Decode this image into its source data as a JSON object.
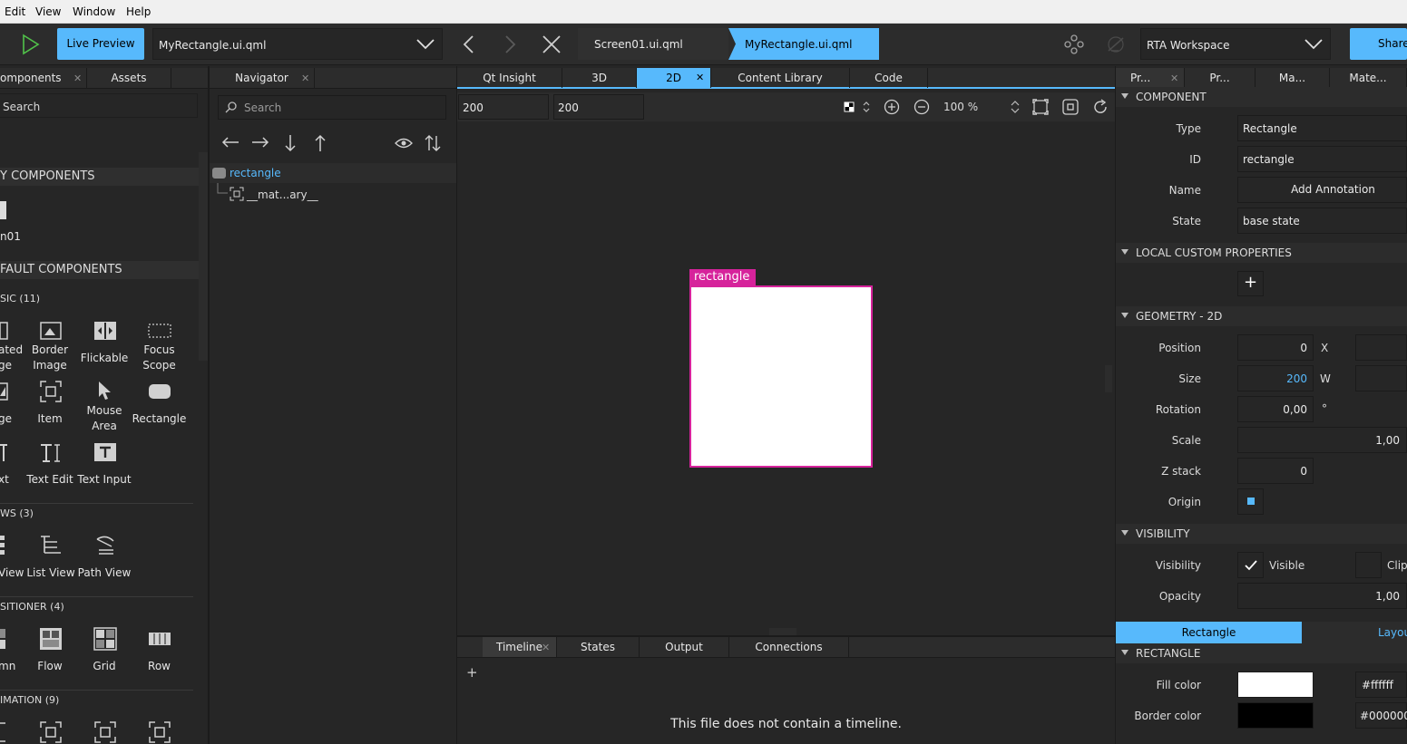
{
  "menu": [
    "Edit",
    "View",
    "Window",
    "Help"
  ],
  "toolbar": {
    "live_preview": "Live Preview",
    "current_file": "MyRectangle.ui.qml",
    "doc_tabs": [
      "Screen01.ui.qml",
      "MyRectangle.ui.qml"
    ],
    "workspace": "RTA Workspace",
    "share": "Share"
  },
  "left_panel": {
    "tabs": [
      "omponents",
      "Assets"
    ],
    "search_placeholder": "Search",
    "my_components_head": "Y COMPONENTS",
    "my_component_item": "n01",
    "default_head": "FAULT COMPONENTS",
    "basic_head": "SIC (11)",
    "basic_row1": [
      "ated\nge",
      "Border\nImage",
      "Flickable",
      "Focus\nScope"
    ],
    "basic_row2": [
      "ge",
      "Item",
      "Mouse\nArea",
      "Rectangle"
    ],
    "basic_row3": [
      "xt",
      "Text Edit",
      "Text Input"
    ],
    "views_head": "WS (3)",
    "views": [
      "View",
      "List View",
      "Path View"
    ],
    "positioner_head": "SITIONER (4)",
    "positioners": [
      "mn",
      "Flow",
      "Grid",
      "Row"
    ],
    "animation_head": "IMATION (9)"
  },
  "navigator": {
    "tab": "Navigator",
    "search_placeholder": "Search",
    "root_item": "rectangle",
    "child_item": "__mat...ary__"
  },
  "center": {
    "tabs": [
      "Qt Insight",
      "3D",
      "2D",
      "Content Library",
      "Code"
    ],
    "width_value": "200",
    "height_value": "200",
    "zoom": "100 %",
    "selection_label": "rectangle",
    "bottom_tabs": [
      "Timeline",
      "States",
      "Output",
      "Connections"
    ],
    "add_symbol": "+",
    "timeline_message": "This file does not contain a timeline."
  },
  "properties": {
    "tabs": [
      "Pr...",
      "Pr...",
      "Ma...",
      "Mate..."
    ],
    "component_head": "COMPONENT",
    "type_label": "Type",
    "type_value": "Rectangle",
    "id_label": "ID",
    "id_value": "rectangle",
    "name_label": "Name",
    "add_annotation": "Add Annotation",
    "state_label": "State",
    "state_value": "base state",
    "local_custom_head": "LOCAL CUSTOM PROPERTIES",
    "plus": "+",
    "geometry_head": "GEOMETRY - 2D",
    "position_label": "Position",
    "position_x": "0",
    "x_label": "X",
    "size_label": "Size",
    "size_w": "200",
    "w_label": "W",
    "rotation_label": "Rotation",
    "rotation_value": "0,00",
    "degree": "°",
    "scale_label": "Scale",
    "scale_value": "1,00",
    "zstack_label": "Z stack",
    "zstack_value": "0",
    "origin_label": "Origin",
    "visibility_head": "VISIBILITY",
    "visibility_label": "Visibility",
    "visible_text": "Visible",
    "clip_text": "Clip",
    "opacity_label": "Opacity",
    "opacity_value": "1,00",
    "section_tabs": [
      "Rectangle",
      "Layou"
    ],
    "rectangle_head": "RECTANGLE",
    "fill_label": "Fill color",
    "fill_hex": "#ffffff",
    "border_label": "Border color",
    "border_hex": "#000000"
  },
  "colors": {
    "accent": "#57b9fc",
    "selection": "#d6239b",
    "fill": "#ffffff",
    "border": "#000000"
  }
}
